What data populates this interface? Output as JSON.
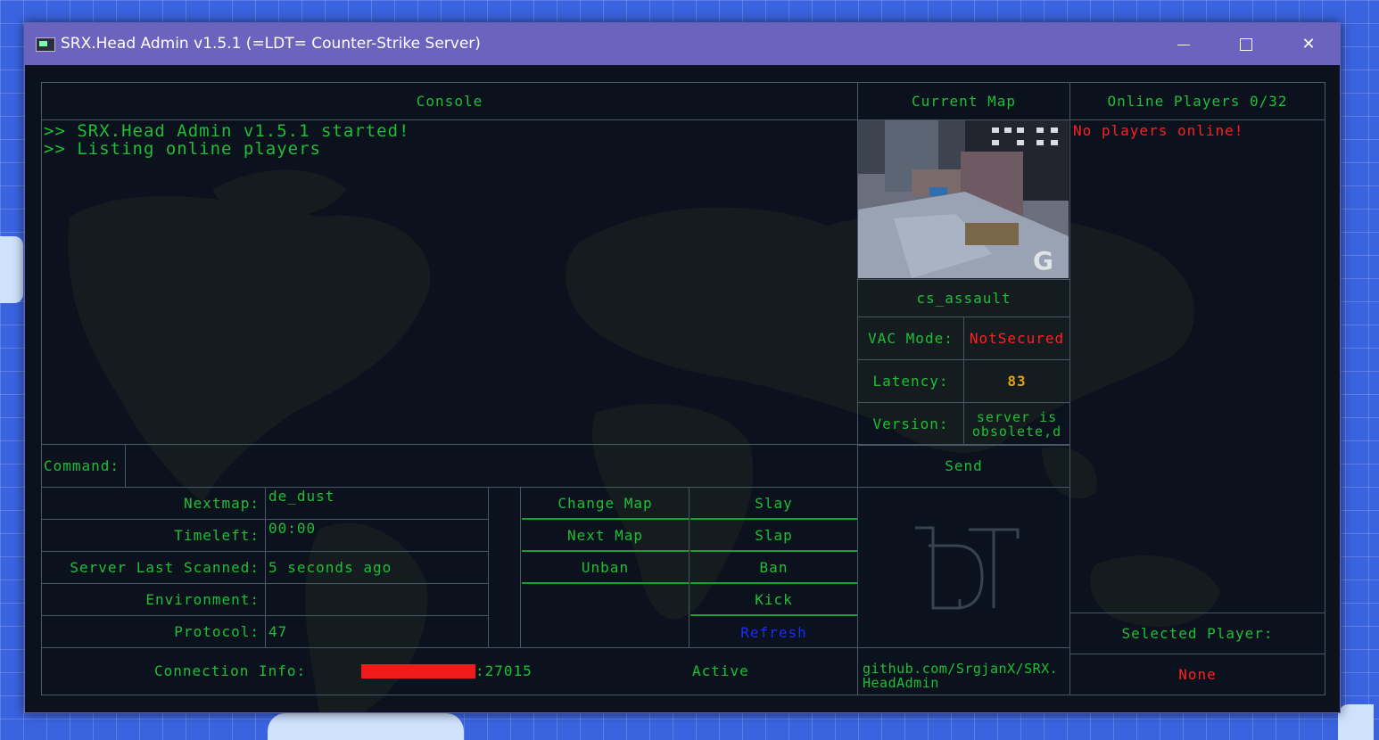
{
  "window": {
    "title": "SRX.Head Admin v1.5.1 (=LDT= Counter-Strike Server)",
    "minimize_icon": "minimize-icon",
    "maximize_icon": "maximize-icon",
    "close_icon": "close-icon"
  },
  "console": {
    "header": "Console",
    "lines": [
      ">> SRX.Head Admin v1.5.1 started!",
      ">> Listing online players"
    ]
  },
  "current_map": {
    "header": "Current Map",
    "name": "cs_assault",
    "vac_label": "VAC Mode:",
    "vac_value": "NotSecured",
    "latency_label": "Latency:",
    "latency_value": "83",
    "version_label": "Version:",
    "version_value": "server is obsolete,d"
  },
  "players": {
    "header": "Online Players 0/32",
    "empty_message": "No players online!",
    "selected_label": "Selected Player:",
    "selected_value": "None"
  },
  "command": {
    "label": "Command:",
    "value": "",
    "send_label": "Send"
  },
  "info": {
    "nextmap_label": "Nextmap:",
    "nextmap_value": "de_dust",
    "timeleft_label": "Timeleft:",
    "timeleft_value": "00:00",
    "scanned_label": "Server Last Scanned:",
    "scanned_value": "5 seconds ago",
    "environment_label": "Environment:",
    "environment_value": "",
    "protocol_label": "Protocol:",
    "protocol_value": "47"
  },
  "actions": {
    "change_map": "Change Map",
    "next_map": "Next Map",
    "unban": "Unban",
    "slay": "Slay",
    "slap": "Slap",
    "ban": "Ban",
    "kick": "Kick",
    "refresh": "Refresh"
  },
  "footer": {
    "connection_label": "Connection Info:",
    "connection_port": ":27015",
    "status": "Active",
    "github": "github.com/SrgjanX/SRX.HeadAdmin"
  },
  "colors": {
    "accent_green": "#1fbf35",
    "alert_red": "#ff2020",
    "latency_orange": "#e6a20e",
    "refresh_blue": "#1a2cff",
    "titlebar": "#6b63bd"
  }
}
